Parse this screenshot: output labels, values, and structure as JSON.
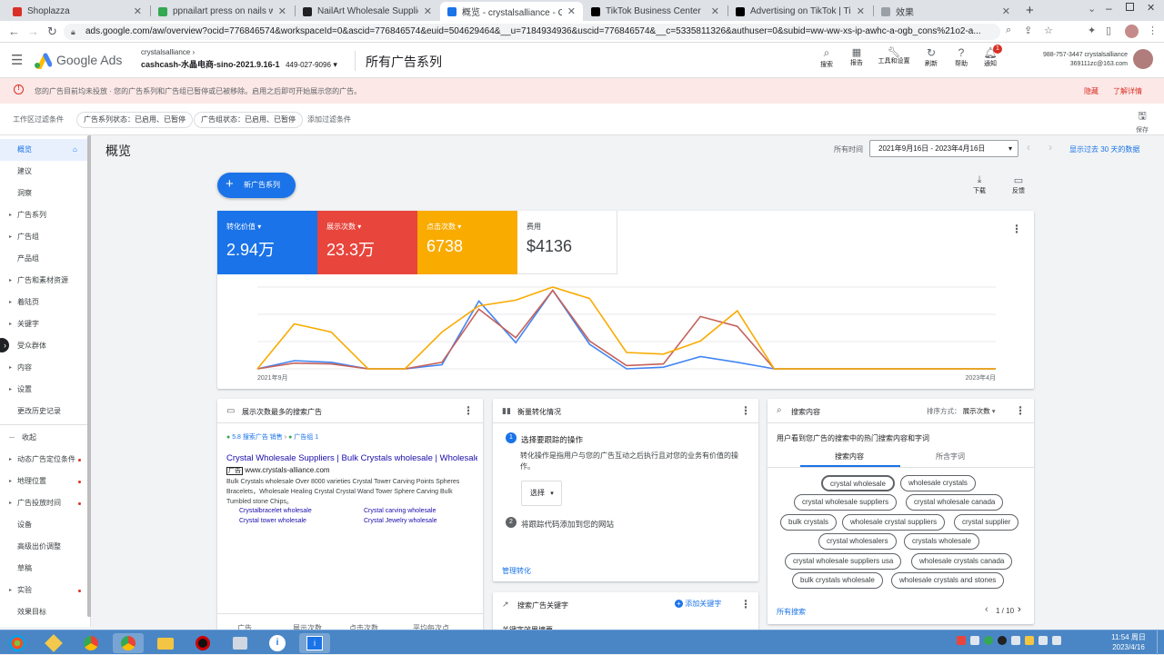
{
  "browser": {
    "tabs": [
      {
        "label": "Shoplazza",
        "color": "#d93025"
      },
      {
        "label": "ppnailart press on nails whole",
        "color": "#34a853"
      },
      {
        "label": "NailArt Wholesale Suppliers, B",
        "color": "#202124"
      },
      {
        "label": "概览 - crystalsalliance - Google",
        "color": "#1a73e8"
      },
      {
        "label": "TikTok Business Center",
        "color": "#000000"
      },
      {
        "label": "Advertising on TikTok | TikTok",
        "color": "#000000"
      },
      {
        "label": "效果",
        "color": "#5f6368"
      }
    ],
    "url": "ads.google.com/aw/overview?ocid=776846574&workspaceId=0&ascid=776846574&euid=504629464&__u=7184934936&uscid=776846574&__c=5335811326&authuser=0&subid=ww-ww-xs-ip-awhc-a-ogb_cons%21o2-a..."
  },
  "header": {
    "product": "Google Ads",
    "account_name": "crystalsalliance",
    "account_sub": "cashcash-水晶电商-sino-2021.9.16-1",
    "account_id": "449-027-9096",
    "page_title": "所有广告系列",
    "tools": [
      "搜索",
      "报告",
      "工具和设置",
      "刷新",
      "帮助",
      "通知"
    ],
    "notif_count": "1",
    "user_phone": "988-757-3447 crystalsalliance",
    "user_email": "369111zc@163.com"
  },
  "notice": {
    "text": "您的广告目前均未投放 · 您的广告系列和广告组已暂停或已被移除。启用之后即可开始展示您的广告。",
    "dismiss": "隐藏",
    "learn": "了解详情"
  },
  "filters": {
    "label": "工作区过滤条件",
    "chip1": "广告系列状态：已启用、已暂停",
    "chip2": "广告组状态：已启用、已暂停",
    "add": "添加过滤条件",
    "save": "保存"
  },
  "sidebar": {
    "items": [
      {
        "label": "概览",
        "expand": false,
        "dot": false
      },
      {
        "label": "建议",
        "expand": false,
        "dot": false
      },
      {
        "label": "洞察",
        "expand": false,
        "dot": false
      },
      {
        "label": "广告系列",
        "expand": true,
        "dot": false
      },
      {
        "label": "广告组",
        "expand": true,
        "dot": false
      },
      {
        "label": "产品组",
        "expand": false,
        "dot": false
      },
      {
        "label": "广告和素材资源",
        "expand": true,
        "dot": false
      },
      {
        "label": "着陆页",
        "expand": true,
        "dot": false
      },
      {
        "label": "关键字",
        "expand": true,
        "dot": false
      },
      {
        "label": "受众群体",
        "expand": false,
        "dot": false
      },
      {
        "label": "内容",
        "expand": true,
        "dot": false
      },
      {
        "label": "设置",
        "expand": true,
        "dot": false
      },
      {
        "label": "更改历史记录",
        "expand": false,
        "dot": false
      },
      {
        "label": "收起",
        "expand": false,
        "dot": false
      },
      {
        "label": "动态广告定位条件",
        "expand": true,
        "dot": true
      },
      {
        "label": "地理位置",
        "expand": true,
        "dot": true
      },
      {
        "label": "广告投放时间",
        "expand": true,
        "dot": true
      },
      {
        "label": "设备",
        "expand": false,
        "dot": false
      },
      {
        "label": "高级出价调整",
        "expand": false,
        "dot": false
      },
      {
        "label": "草稿",
        "expand": false,
        "dot": false
      },
      {
        "label": "实验",
        "expand": true,
        "dot": true
      },
      {
        "label": "效果目标",
        "expand": false,
        "dot": false
      }
    ]
  },
  "overview": {
    "title": "概览",
    "date_label": "所有时间",
    "date_range": "2021年9月16日 - 2023年4月16日",
    "last30": "显示过去 30 天的数据",
    "new_campaign": "新广告系列",
    "download": "下载",
    "feedback": "反馈"
  },
  "kpis": [
    {
      "label": "转化价值",
      "value": "2.94万",
      "color": "#1a73e8"
    },
    {
      "label": "展示次数",
      "value": "23.3万",
      "color": "#e8453c"
    },
    {
      "label": "点击次数",
      "value": "6738",
      "color": "#f9ab00"
    },
    {
      "label": "费用",
      "value": "$4136",
      "color": "#ffffff"
    }
  ],
  "chart_data": {
    "type": "line",
    "x_start_label": "2021年9月",
    "x_end_label": "2023年4月",
    "series": [
      {
        "name": "转化价值",
        "color": "#4285f4",
        "values": [
          0,
          0.1,
          0.08,
          0,
          0,
          0.05,
          0.83,
          0.32,
          0.96,
          0.3,
          0,
          0.02,
          0.15,
          0.08,
          0,
          0,
          0,
          0,
          0,
          0,
          0
        ]
      },
      {
        "name": "展示次数",
        "color": "#c5625a",
        "values": [
          0,
          0.07,
          0.06,
          0,
          0,
          0.08,
          0.73,
          0.38,
          0.96,
          0.34,
          0.04,
          0.06,
          0.64,
          0.52,
          0,
          0,
          0,
          0,
          0,
          0,
          0
        ]
      },
      {
        "name": "点击次数",
        "color": "#f9ab00",
        "values": [
          0,
          0.55,
          0.45,
          0,
          0,
          0.45,
          0.77,
          0.84,
          1,
          0.86,
          0.2,
          0.18,
          0.34,
          0.71,
          0,
          0,
          0,
          0,
          0,
          0,
          0
        ]
      }
    ]
  },
  "top_ads": {
    "title": "展示次数最多的搜索广告",
    "breadcrumb1": "5.8 搜索广告 销售",
    "breadcrumb2": "广告组 1",
    "headline": "Crystal Wholesale Suppliers | Bulk Crystals wholesale | Wholesale...",
    "ad_badge": "广告",
    "display_url": "www.crystals-alliance.com",
    "desc": "Bulk Crystals wholesale Over 8000 varieties Crystal Tower Carving Points Spheres Bracelets，Wholesale Healing Crystal Crystal Wand Tower Sphere Carving Bulk Tumbled stone Chips。",
    "sitelinks": [
      "Crystalbracelet wholesale",
      "Crystal carving wholesale",
      "Crystal tower wholesale",
      "Crystal Jewelry wholesale"
    ],
    "cols": [
      "广告",
      "展示次数",
      "点击次数",
      "平均每次点"
    ]
  },
  "conversions": {
    "title": "衡量转化情况",
    "step1": "选择要跟踪的操作",
    "step1_desc": "转化操作是指用户与您的广告互动之后执行且对您的业务有价值的操作。",
    "select": "选择",
    "step2": "将跟踪代码添加到您的网站",
    "manage": "管理转化"
  },
  "keywords": {
    "title": "搜索广告关键字",
    "add": "添加关键字",
    "sub": "关键字效果摘要"
  },
  "search_terms": {
    "title": "搜索内容",
    "sort_label": "排序方式：",
    "sort_value": "展示次数",
    "desc": "用户看到您广告的搜索中的热门搜索内容和字词",
    "tab1": "搜索内容",
    "tab2": "所含字词",
    "terms": [
      "crystal wholesale",
      "wholesale crystals",
      "crystal wholesale suppliers",
      "crystal wholesale canada",
      "bulk crystals",
      "wholesale crystal suppliers",
      "crystal supplier",
      "crystal wholesalers",
      "crystals wholesale",
      "crystal wholesale suppliers usa",
      "wholesale crystals canada",
      "bulk crystals wholesale",
      "wholesale crystals and stones"
    ],
    "all": "所有搜索",
    "pager": "1 / 10"
  },
  "taskbar": {
    "time": "11:54 周日",
    "date": "2023/4/16"
  }
}
